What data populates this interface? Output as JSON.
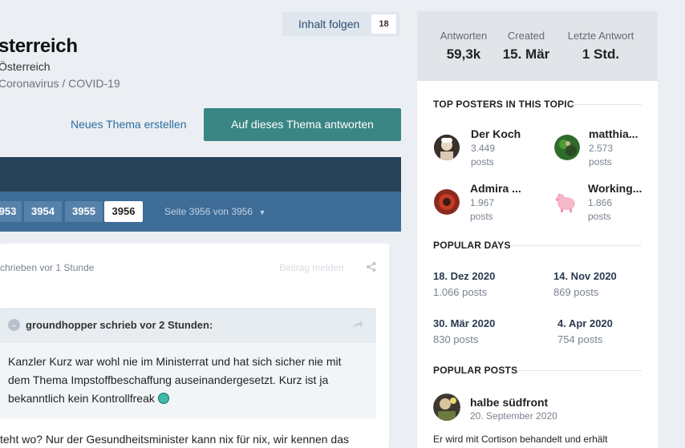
{
  "header": {
    "follow_label": "Inhalt folgen",
    "follow_count": "18",
    "title": "sterreich",
    "forum": "Österreich",
    "category": "Coronavirus / COVID-19",
    "new_topic_label": "Neues Thema erstellen",
    "reply_label": "Auf dieses Thema antworten"
  },
  "pagination": {
    "pages": [
      "953",
      "3954",
      "3955",
      "3956"
    ],
    "active_page": "3956",
    "page_of": "Seite 3956 von 3956"
  },
  "post": {
    "meta": "chrieben vor 1 Stunde",
    "meta_right": "Beitrag melden",
    "quote_author": "groundhopper schrieb vor 2 Stunden:",
    "quote_line1": "Kanzler Kurz war wohl nie im Ministerrat und hat sich sicher nie mit",
    "quote_line2": "dem Thema Impstoffbeschaffung auseinandergesetzt. Kurz ist ja",
    "quote_line3": "bekanntlich kein Kontrollfreak",
    "body": "teht wo? Nur der Gesundheitsminister kann nix für nix, wir kennen das"
  },
  "sidebar": {
    "stats": [
      {
        "label": "Antworten",
        "value": "59,3k"
      },
      {
        "label": "Created",
        "value": "15. Mär"
      },
      {
        "label": "Letzte Antwort",
        "value": "1 Std."
      }
    ],
    "top_posters_title": "TOP POSTERS IN THIS TOPIC",
    "top_posters": [
      {
        "name": "Der Koch",
        "count": "3.449",
        "unit": "posts"
      },
      {
        "name": "matthia...",
        "count": "2.573",
        "unit": "posts"
      },
      {
        "name": "Admira ...",
        "count": "1.967",
        "unit": "posts"
      },
      {
        "name": "Working...",
        "count": "1.866",
        "unit": "posts"
      }
    ],
    "popular_days_title": "POPULAR DAYS",
    "popular_days": [
      {
        "date": "18. Dez 2020",
        "count": "1.066 posts"
      },
      {
        "date": "14. Nov 2020",
        "count": "869 posts"
      },
      {
        "date": "30. Mär 2020",
        "count": "830 posts"
      },
      {
        "date": "4. Apr 2020",
        "count": "754 posts"
      }
    ],
    "popular_posts_title": "POPULAR POSTS",
    "popular_post": {
      "author": "halbe südfront",
      "date": "20. September 2020",
      "excerpt": "Er wird mit Cortison behandelt und erhält"
    }
  },
  "colors": {
    "accent": "#3a8684",
    "nav_dark": "#28425a",
    "nav_blue": "#3d6c97"
  }
}
